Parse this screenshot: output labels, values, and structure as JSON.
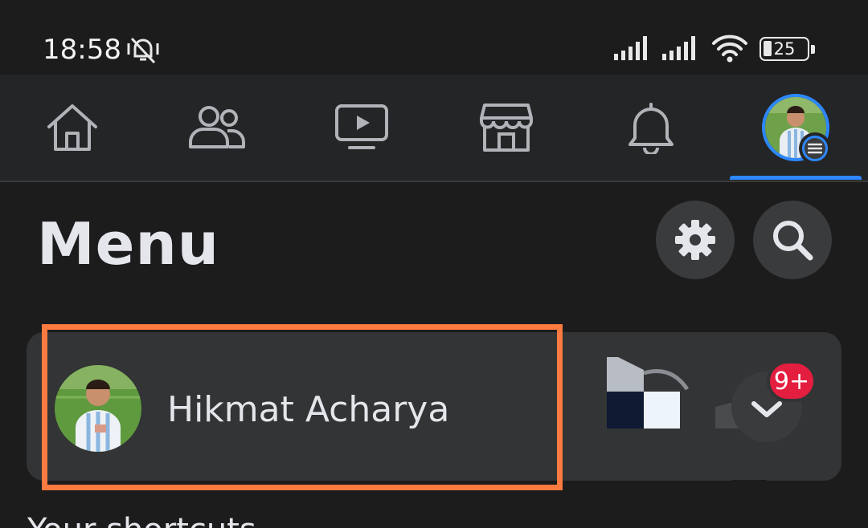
{
  "status_bar": {
    "time": "18:58",
    "battery_level": "25",
    "icons": [
      "mute-vibrate-icon",
      "signal-icon",
      "signal-icon",
      "wifi-icon",
      "battery-icon"
    ]
  },
  "tab_bar": {
    "tabs": [
      {
        "name": "home",
        "icon": "home-icon"
      },
      {
        "name": "friends",
        "icon": "friends-icon"
      },
      {
        "name": "watch",
        "icon": "video-icon"
      },
      {
        "name": "marketplace",
        "icon": "marketplace-icon"
      },
      {
        "name": "notifications",
        "icon": "bell-icon"
      },
      {
        "name": "menu",
        "icon": "profile-avatar",
        "active": true
      }
    ],
    "accent_color": "#2d88ff"
  },
  "header": {
    "title": "Menu",
    "settings_icon": "gear-icon",
    "search_icon": "search-icon"
  },
  "profile": {
    "name": "Hikmat Acharya",
    "notification_count": "9+",
    "highlight_color": "#ff7a40",
    "badge_color": "#e41e3f"
  },
  "shortcuts": {
    "title": "Your shortcuts"
  }
}
